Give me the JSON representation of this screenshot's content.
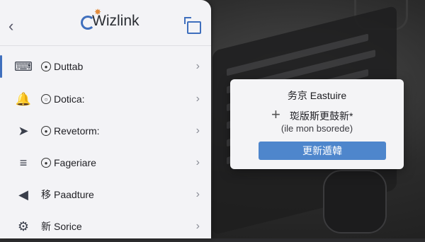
{
  "app": {
    "title": "Wizlink"
  },
  "menu": [
    {
      "label": "Duttab",
      "icon": "keyboard-icon",
      "active": true
    },
    {
      "label": "Dotica:",
      "icon": "bell-icon",
      "active": false
    },
    {
      "label": "Revetorm:",
      "icon": "rocket-icon",
      "active": false
    },
    {
      "label": "Fageriare",
      "icon": "sliders-icon",
      "active": false
    },
    {
      "label": "Paadture",
      "prefix": "移",
      "icon": "megaphone-icon",
      "active": false
    },
    {
      "label": "Sorice",
      "prefix": "新",
      "icon": "gear-icon",
      "active": false
    }
  ],
  "dialog": {
    "title": "务京 Eastuire",
    "message": "珳版斯更鼓新*",
    "subtext": "(ile mon bsorede)",
    "button": "更新遁韓"
  },
  "colors": {
    "accent": "#3f6fbd",
    "button": "#4e86cc"
  }
}
